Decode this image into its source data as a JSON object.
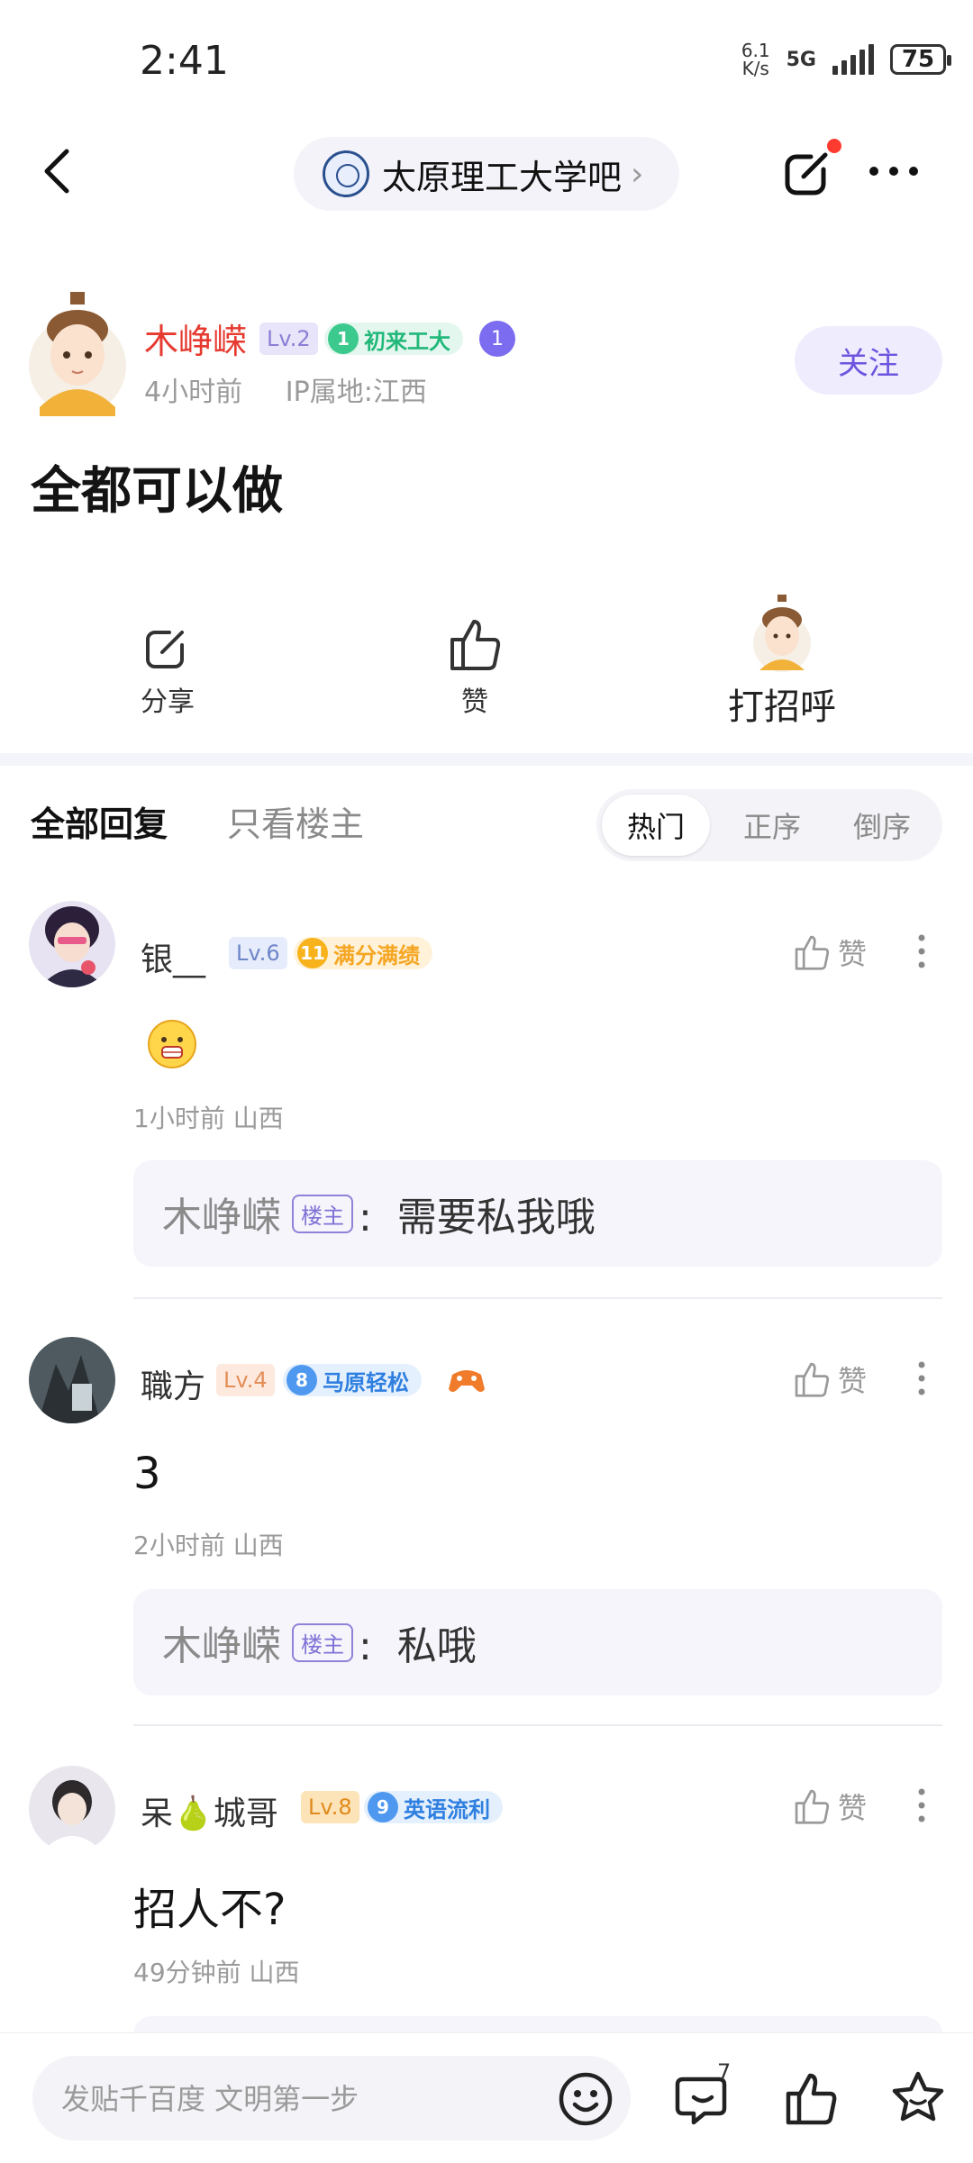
{
  "status_bar": {
    "time": "2:41",
    "net_speed_top": "6.1",
    "net_speed_bottom": "K/s",
    "network": "5G",
    "battery": "75"
  },
  "header": {
    "forum_name": "太原理工大学吧"
  },
  "post": {
    "author": {
      "name": "木峥嵘",
      "level": "Lv.2",
      "title_num": "1",
      "title": "初来工大",
      "time": "4小时前",
      "ip": "IP属地:江西",
      "follow_label": "关注"
    },
    "title": "全都可以做",
    "actions": {
      "share": "分享",
      "like": "赞",
      "greet": "打招呼"
    }
  },
  "replies_header": {
    "tab_all": "全部回复",
    "tab_owner": "只看楼主",
    "sort": [
      "热门",
      "正序",
      "倒序"
    ]
  },
  "replies": [
    {
      "name": "银__",
      "level": "Lv.6",
      "title_num": "11",
      "title": "满分满绩",
      "content": "",
      "time": "1小时前  山西",
      "like_label": "赞",
      "sub_author": "木峥嵘",
      "owner_tag": "楼主",
      "sub_text": "需要私我哦"
    },
    {
      "name": "職方",
      "level": "Lv.4",
      "title_num": "8",
      "title": "马原轻松",
      "content": "3",
      "time": "2小时前  山西",
      "like_label": "赞",
      "sub_author": "木峥嵘",
      "owner_tag": "楼主",
      "sub_text": "私哦"
    },
    {
      "name": "呆🍐城哥",
      "level": "Lv.8",
      "title_num": "9",
      "title": "英语流利",
      "content": "招人不?",
      "time": "49分钟前  山西",
      "like_label": "赞"
    }
  ],
  "bottom_bar": {
    "placeholder": "发贴千百度 文明第一步",
    "comment_count": "7"
  },
  "colors": {
    "accent": "#6e55e0",
    "author_name": "#e6392f",
    "owner_tag": "#7f72d6"
  }
}
